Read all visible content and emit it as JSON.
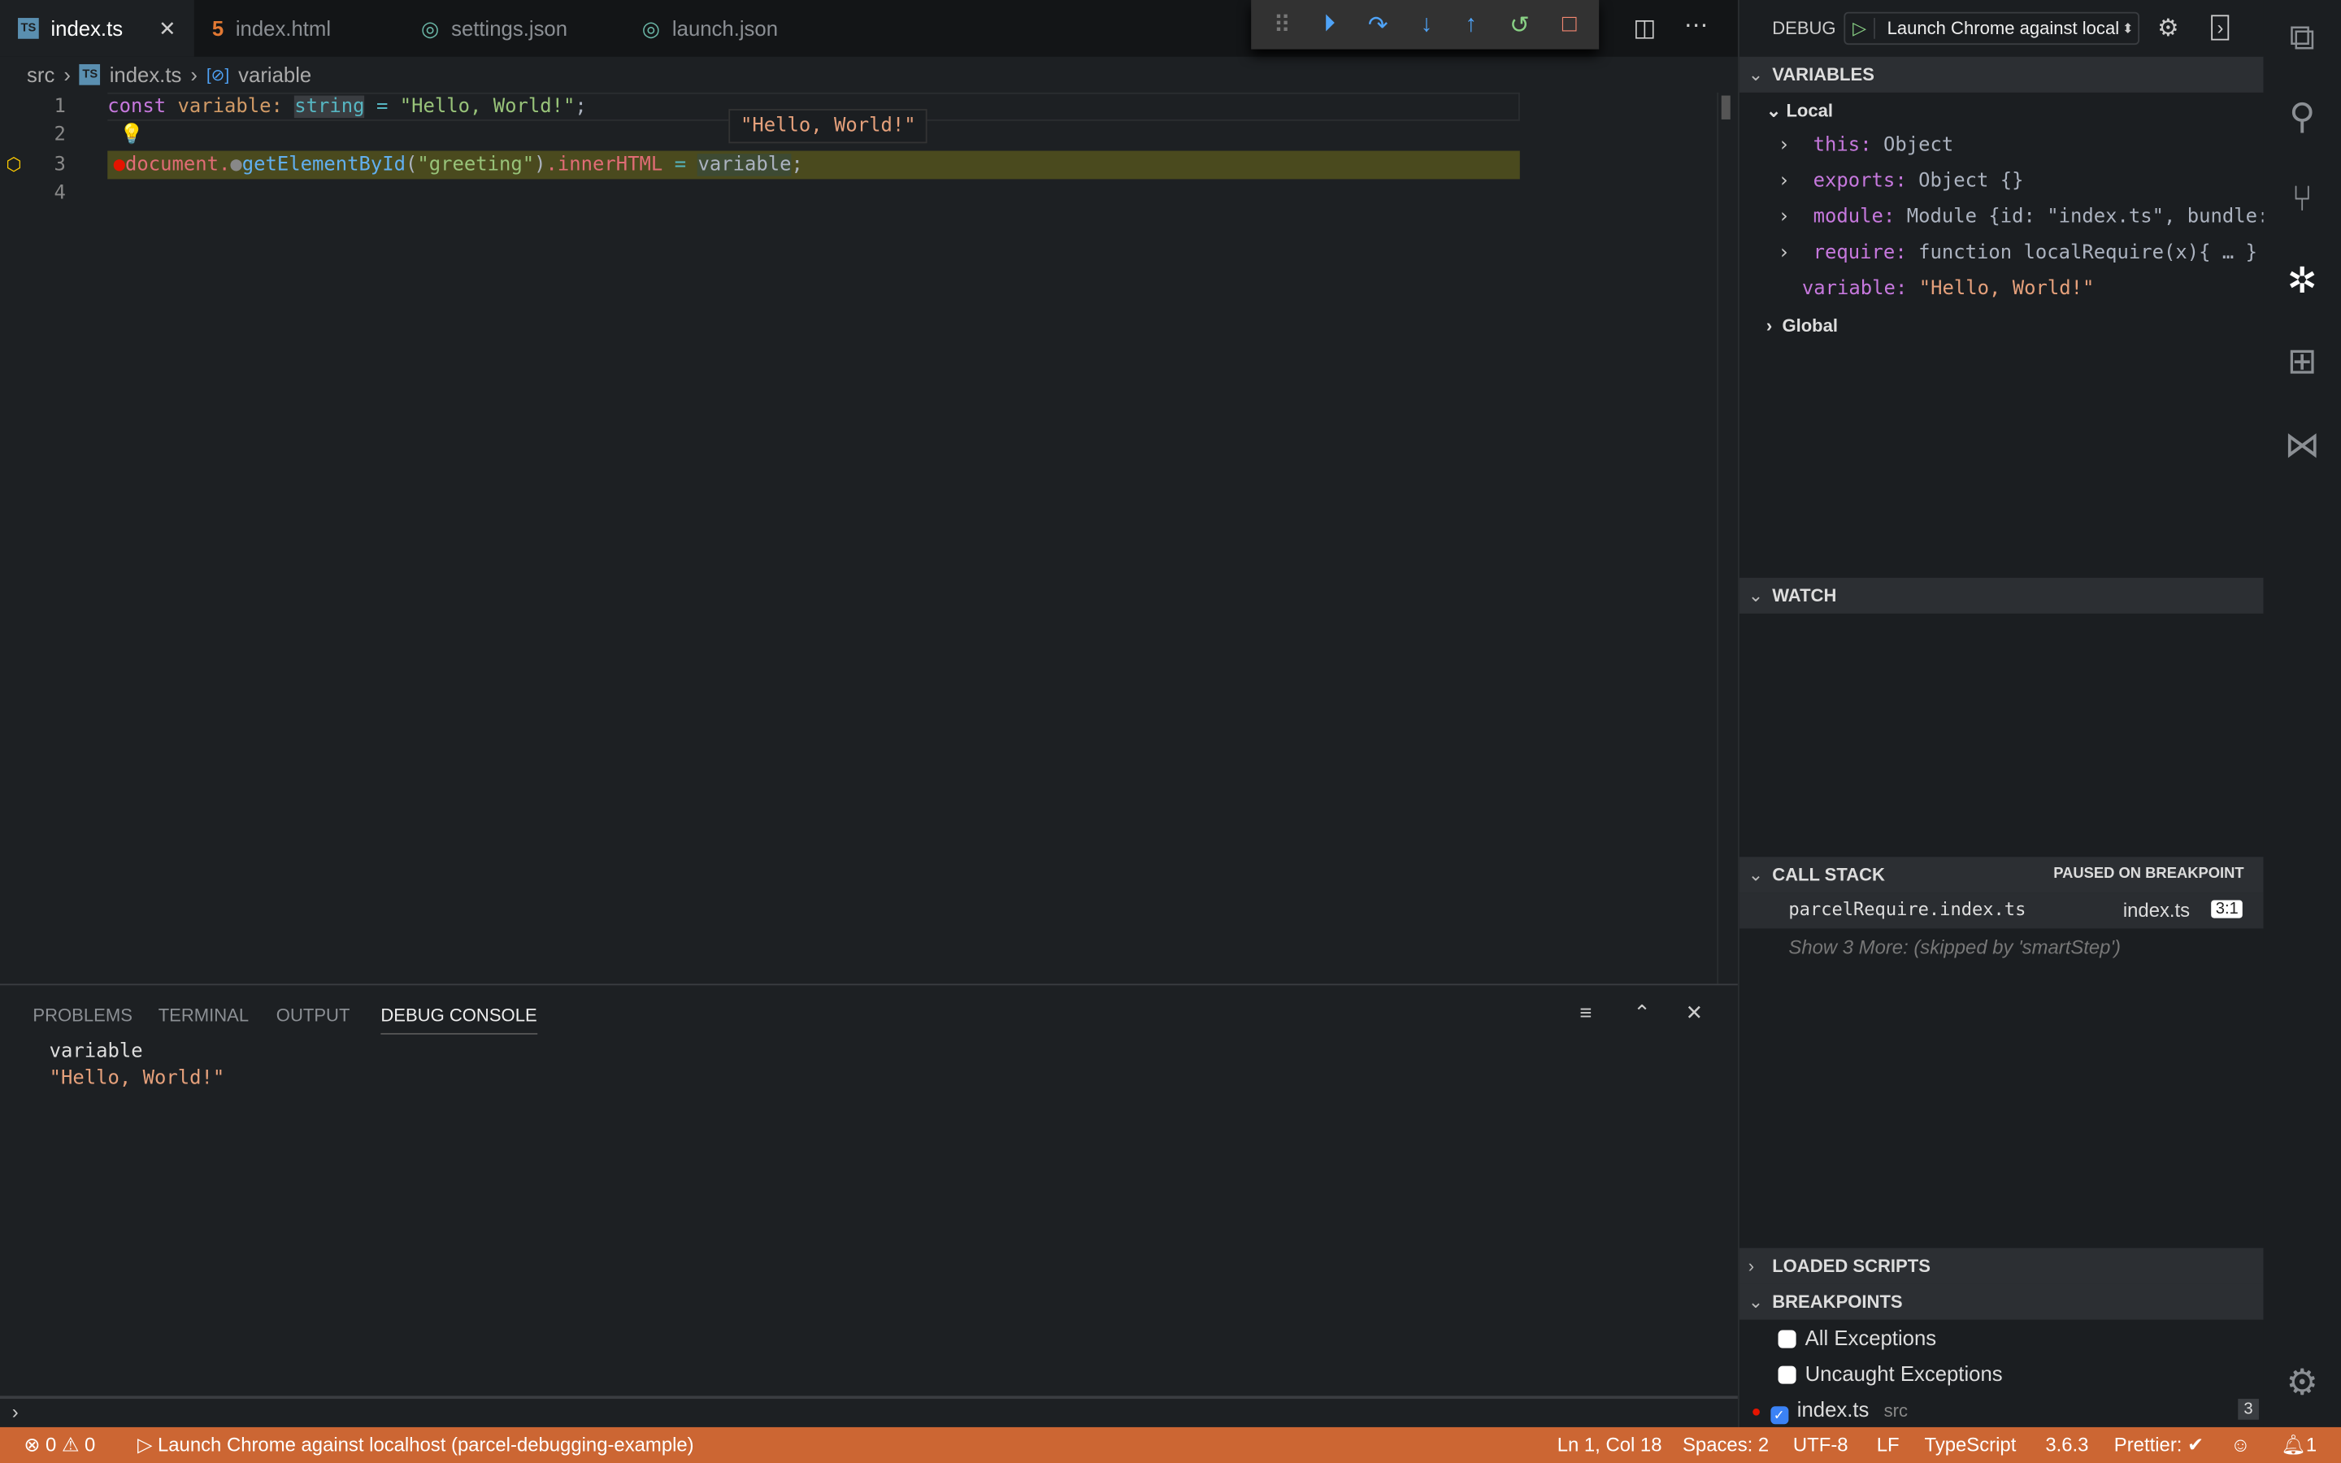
{
  "tabs": [
    {
      "label": "index.ts",
      "icon": "typescript-icon",
      "active": true
    },
    {
      "label": "index.html",
      "icon": "html5-icon"
    },
    {
      "label": "settings.json",
      "icon": "json-icon"
    },
    {
      "label": "launch.json",
      "icon": "json-icon"
    }
  ],
  "breadcrumb": {
    "folder": "src",
    "file": "index.ts",
    "symbol": "variable"
  },
  "editor": {
    "lines": [
      {
        "n": "1",
        "const": "const",
        "name": "variable",
        "colon": ":",
        "type": "string",
        "eq": "=",
        "str": "\"Hello, World!\"",
        "semi": ";"
      },
      {
        "n": "2"
      },
      {
        "n": "3",
        "obj": "document",
        "dot": ".",
        "fn": "getElementById",
        "open": "(",
        "arg": "\"greeting\"",
        "close": ")",
        "prop": ".innerHTML",
        "eq": " = ",
        "val": "variable",
        "semi": ";"
      },
      {
        "n": "4"
      }
    ],
    "hover": "\"Hello, World!\""
  },
  "debug_toolbar": [
    "continue",
    "step-over",
    "step-into",
    "step-out",
    "restart",
    "stop"
  ],
  "panel": {
    "tabs": [
      "PROBLEMS",
      "TERMINAL",
      "OUTPUT",
      "DEBUG CONSOLE"
    ],
    "active": "DEBUG CONSOLE",
    "console": {
      "input": "variable",
      "output": "\"Hello, World!\""
    }
  },
  "sidebar": {
    "title": "DEBUG",
    "config": "Launch Chrome against local",
    "variables": {
      "title": "VARIABLES",
      "scope": "Local",
      "items": [
        {
          "key": "this",
          "value": " Object",
          "expandable": true
        },
        {
          "key": "exports",
          "value": " Object {}",
          "expandable": true
        },
        {
          "key": "module",
          "value": " Module {id: \"index.ts\", bundle: , …",
          "expandable": true
        },
        {
          "key": "require",
          "value": " function localRequire(x){ … }",
          "expandable": true
        },
        {
          "key": "variable",
          "value": " \"Hello, World!\"",
          "expandable": false
        }
      ],
      "global": "Global"
    },
    "watch": {
      "title": "WATCH"
    },
    "callstack": {
      "title": "CALL STACK",
      "status": "PAUSED ON BREAKPOINT",
      "frame": "parcelRequire.index.ts",
      "file": "index.ts",
      "pos": "3:1",
      "more": "Show 3 More: (skipped by 'smartStep')"
    },
    "loaded": {
      "title": "LOADED SCRIPTS"
    },
    "breakpoints": {
      "title": "BREAKPOINTS",
      "items": [
        {
          "label": "All Exceptions",
          "checked": false
        },
        {
          "label": "Uncaught Exceptions",
          "checked": false
        },
        {
          "label": "index.ts",
          "path": "src",
          "line": "3",
          "checked": true
        }
      ]
    }
  },
  "status": {
    "errors": "0",
    "warnings": "0",
    "launch": "Launch Chrome against localhost (parcel-debugging-example)",
    "pos": "Ln 1, Col 18",
    "spaces": "Spaces: 2",
    "enc": "UTF-8",
    "eol": "LF",
    "lang": "TypeScript",
    "ver": "3.6.3",
    "prettier": "Prettier: ✔",
    "bell": "1"
  },
  "colors": {
    "status": "#cc6633",
    "current_line": "#4a4a1e",
    "breakpoint": "#e51400"
  }
}
